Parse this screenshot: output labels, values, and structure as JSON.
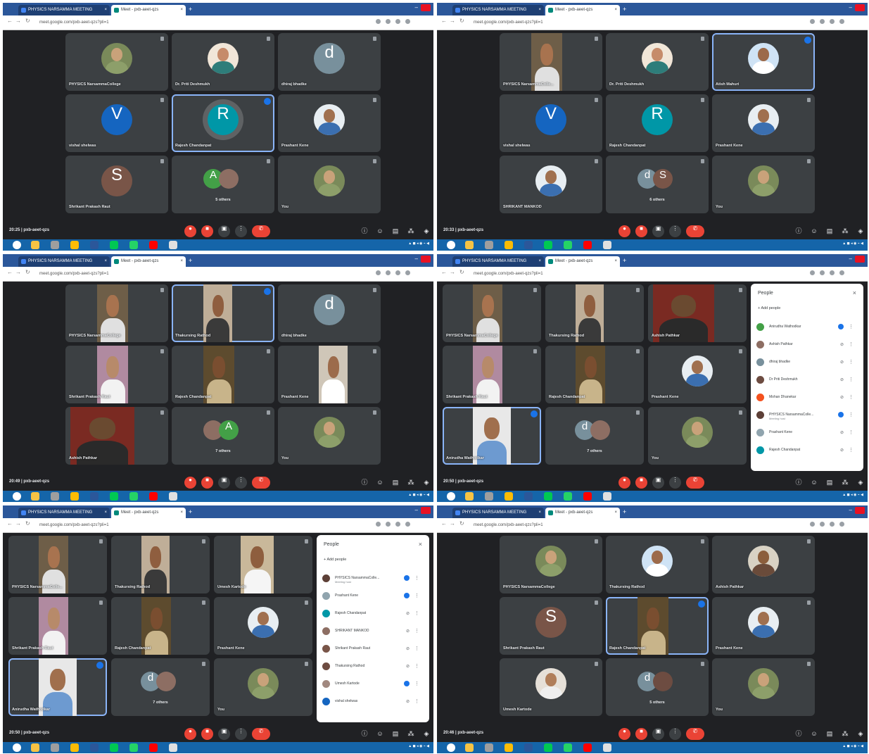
{
  "browser": {
    "tab1_title": "PHYSICS NARSAMMA MEETING",
    "tab2_title": "Meet - pxb-aeet-qzs",
    "url": "meet.google.com/pxb-aeet-qzs?pli=1",
    "url_sub": "meet.google.com/pxb-aeet-qzs?pli=1"
  },
  "meeting": {
    "code": "pxb-aeet-qzs",
    "separator": "|"
  },
  "colors": {
    "meet_bg": "#202124",
    "tile_bg": "#3c4043",
    "active_outline": "#8ab4f8",
    "end_call_red": "#ea4335",
    "taskbar_blue": "#1565a9"
  },
  "screens": [
    {
      "time": "20:25",
      "tiles": [
        {
          "name": "PHYSICS NarsammaCollege",
          "kind": "photo",
          "photo": "group"
        },
        {
          "name": "Dr. Priti Deshmukh",
          "kind": "photo",
          "photo": "woman"
        },
        {
          "name": "dhiraj bhadke",
          "kind": "letter",
          "letter": "d",
          "color": "#78909c"
        },
        {
          "name": "vishal shelwas",
          "kind": "letter",
          "letter": "V",
          "color": "#1565c0"
        },
        {
          "name": "Rajesh Chandanpat",
          "kind": "letter",
          "letter": "R",
          "color": "#0097a7",
          "active": true
        },
        {
          "name": "Prashant Kene",
          "kind": "photo",
          "photo": "man-white"
        },
        {
          "name": "Shrikant Prakash Raut",
          "kind": "letter",
          "letter": "S",
          "color": "#795548"
        },
        {
          "name": "5 others",
          "kind": "pair",
          "a": "A",
          "ac": "#43a047",
          "b": "",
          "bc": "#8d6e63"
        },
        {
          "name": "You",
          "kind": "photo",
          "photo": "group"
        }
      ]
    },
    {
      "time": "20:33",
      "tiles": [
        {
          "name": "PHYSICS NarsammaColle...",
          "kind": "video",
          "video": "man-desk"
        },
        {
          "name": "Dr. Priti Deshmukh",
          "kind": "photo",
          "photo": "woman"
        },
        {
          "name": "Atish Mahuri",
          "kind": "photo",
          "photo": "man-blue",
          "active": true
        },
        {
          "name": "vishal shelwas",
          "kind": "letter",
          "letter": "V",
          "color": "#1565c0"
        },
        {
          "name": "Rajesh Chandanpat",
          "kind": "letter",
          "letter": "R",
          "color": "#0097a7"
        },
        {
          "name": "Prashant Kene",
          "kind": "photo",
          "photo": "man-white"
        },
        {
          "name": "SHRIKANT MANKOD",
          "kind": "photo",
          "photo": "man-white"
        },
        {
          "name": "6 others",
          "kind": "pair",
          "a": "d",
          "ac": "#78909c",
          "b": "S",
          "bc": "#795548"
        },
        {
          "name": "You",
          "kind": "photo",
          "photo": "group"
        }
      ]
    },
    {
      "time": "20:49",
      "tiles": [
        {
          "name": "PHYSICS NarsammaCollege",
          "kind": "video",
          "video": "man-desk"
        },
        {
          "name": "Thakursing Rathod",
          "kind": "video",
          "video": "man-wall",
          "active": true
        },
        {
          "name": "dhiraj bhadke",
          "kind": "letter",
          "letter": "d",
          "color": "#78909c"
        },
        {
          "name": "Shrikant Prakash Raut",
          "kind": "video",
          "video": "man-pink"
        },
        {
          "name": "Rajesh Chandanpat",
          "kind": "video",
          "video": "man-shelf"
        },
        {
          "name": "Prashant Kene",
          "kind": "video",
          "video": "man-room"
        },
        {
          "name": "Ashish Pathkar",
          "kind": "video",
          "video": "man-curtain"
        },
        {
          "name": "7 others",
          "kind": "pair",
          "a": "",
          "ac": "#8d6e63",
          "b": "A",
          "bc": "#43a047"
        },
        {
          "name": "You",
          "kind": "photo",
          "photo": "group"
        }
      ]
    },
    {
      "time": "20:50",
      "tiles": [
        {
          "name": "PHYSICS NarsammaCollege",
          "kind": "video",
          "video": "man-desk"
        },
        {
          "name": "Thakursing Rathod",
          "kind": "video",
          "video": "man-wall"
        },
        {
          "name": "Ashish Pathkar",
          "kind": "video",
          "video": "man-curtain"
        },
        {
          "name": "Shrikant Prakash Raut",
          "kind": "video",
          "video": "man-pink"
        },
        {
          "name": "Rajesh Chandanpat",
          "kind": "video",
          "video": "man-shelf"
        },
        {
          "name": "Prashant Kene",
          "kind": "photo",
          "photo": "man-white"
        },
        {
          "name": "Anirudha Wathodkar",
          "kind": "video",
          "video": "man-close",
          "active": true
        },
        {
          "name": "7 others",
          "kind": "pair",
          "a": "d",
          "ac": "#78909c",
          "b": "",
          "bc": "#8d6e63"
        },
        {
          "name": "You",
          "kind": "photo",
          "photo": "group"
        }
      ],
      "people": {
        "title": "People",
        "add": "Add people",
        "rows": [
          {
            "name": "Anirudha Wathodkar",
            "sub": "",
            "color": "#43a047",
            "mic": "on"
          },
          {
            "name": "Ashish Pathkar",
            "sub": "",
            "color": "#8d6e63",
            "mic": "off"
          },
          {
            "name": "dhiraj bhadke",
            "sub": "",
            "color": "#78909c",
            "mic": "off"
          },
          {
            "name": "Dr Priti Deshmukh",
            "sub": "",
            "color": "#6d4c41",
            "mic": "off"
          },
          {
            "name": "Mohan Dhanekar",
            "sub": "",
            "color": "#f4511e",
            "mic": "off"
          },
          {
            "name": "PHYSICS NarsammaColle...",
            "sub": "Meeting host",
            "color": "#5d4037",
            "mic": "on"
          },
          {
            "name": "Prashant Kene",
            "sub": "",
            "color": "#90a4ae",
            "mic": "off"
          },
          {
            "name": "Rajesh Chandanpat",
            "sub": "",
            "color": "#0097a7",
            "mic": "off"
          }
        ]
      }
    },
    {
      "time": "20:50",
      "tiles": [
        {
          "name": "PHYSICS NarsammaColle...",
          "kind": "video",
          "video": "man-desk"
        },
        {
          "name": "Thakursing Rathod",
          "kind": "video",
          "video": "man-wall"
        },
        {
          "name": "Umesh Kartode",
          "kind": "video",
          "video": "man-door"
        },
        {
          "name": "Shrikant Prakash Raut",
          "kind": "video",
          "video": "man-pink"
        },
        {
          "name": "Rajesh Chandanpat",
          "kind": "video",
          "video": "man-shelf"
        },
        {
          "name": "Prashant Kene",
          "kind": "photo",
          "photo": "man-white"
        },
        {
          "name": "Anirudha Wathodkar",
          "kind": "video",
          "video": "man-close",
          "active": true
        },
        {
          "name": "7 others",
          "kind": "pair",
          "a": "d",
          "ac": "#78909c",
          "b": "",
          "bc": "#8d6e63"
        },
        {
          "name": "You",
          "kind": "photo",
          "photo": "group"
        }
      ],
      "people": {
        "title": "People",
        "add": "Add people",
        "rows": [
          {
            "name": "PHYSICS NarsammaColle...",
            "sub": "Meeting host",
            "color": "#5d4037",
            "mic": "on"
          },
          {
            "name": "Prashant Kene",
            "sub": "",
            "color": "#90a4ae",
            "mic": "on"
          },
          {
            "name": "Rajesh Chandanpat",
            "sub": "",
            "color": "#0097a7",
            "mic": "off"
          },
          {
            "name": "SHRIKANT MANKOD",
            "sub": "",
            "color": "#8d6e63",
            "mic": "off"
          },
          {
            "name": "Shrikant Prakash Raut",
            "sub": "",
            "color": "#795548",
            "mic": "off"
          },
          {
            "name": "Thakursing Rathod",
            "sub": "",
            "color": "#6d4c41",
            "mic": "off"
          },
          {
            "name": "Umesh Kartode",
            "sub": "",
            "color": "#a1887f",
            "mic": "on"
          },
          {
            "name": "vishal shelwas",
            "sub": "",
            "color": "#1565c0",
            "mic": "off"
          }
        ]
      }
    },
    {
      "time": "20:46",
      "tiles": [
        {
          "name": "PHYSICS NarsammaCollege",
          "kind": "photo",
          "photo": "group"
        },
        {
          "name": "Thakursing Rathod",
          "kind": "photo",
          "photo": "man-blue"
        },
        {
          "name": "Ashish Pathkar",
          "kind": "photo",
          "photo": "man-hat"
        },
        {
          "name": "Shrikant Prakash Raut",
          "kind": "letter",
          "letter": "S",
          "color": "#795548"
        },
        {
          "name": "Rajesh Chandanpat",
          "kind": "video",
          "video": "man-shelf",
          "active": true
        },
        {
          "name": "Prashant Kene",
          "kind": "photo",
          "photo": "man-white"
        },
        {
          "name": "Umesh Kartode",
          "kind": "photo",
          "photo": "man-glasses"
        },
        {
          "name": "5 others",
          "kind": "pair",
          "a": "d",
          "ac": "#78909c",
          "b": "",
          "bc": "#6d4c41"
        },
        {
          "name": "You",
          "kind": "photo",
          "photo": "group"
        }
      ]
    }
  ]
}
